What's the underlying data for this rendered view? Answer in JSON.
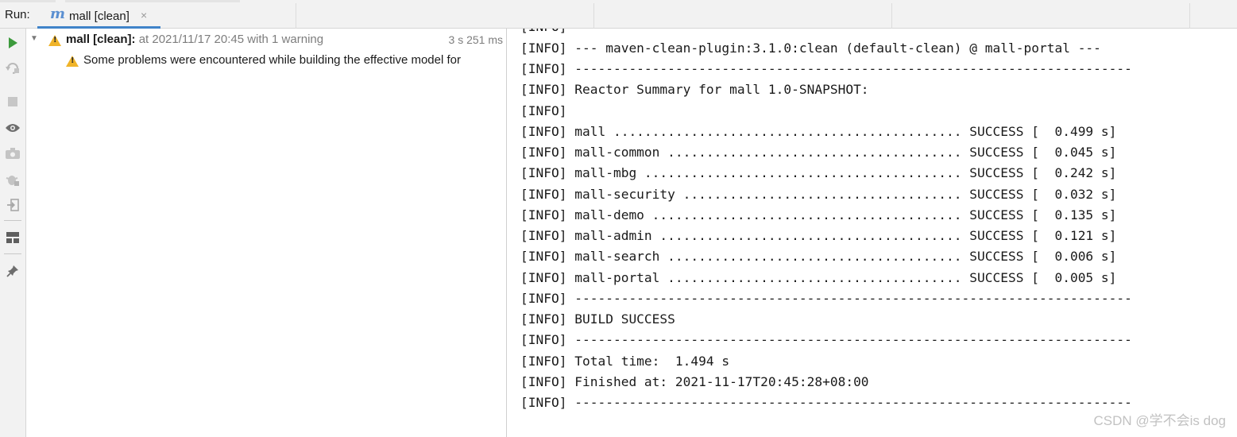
{
  "header": {
    "run_label": "Run:",
    "tab": {
      "label": "mall [clean]",
      "close": "×"
    }
  },
  "toolbar": {
    "icons": [
      "play-icon",
      "rerun-icon",
      "stop-icon",
      "eye-icon",
      "camera-icon",
      "debug-icon",
      "import-icon",
      "layout-icon",
      "pin-icon"
    ]
  },
  "tree": {
    "root": {
      "title": "mall [clean]:",
      "meta": " at 2021/11/17 20:45 with 1 warning",
      "duration": "3 s 251 ms"
    },
    "child": {
      "text": "Some problems were encountered while building the effective model for"
    }
  },
  "console": {
    "lines": [
      "[INFO]",
      "[INFO] --- maven-clean-plugin:3.1.0:clean (default-clean) @ mall-portal ---",
      "[INFO] ------------------------------------------------------------------------",
      "[INFO] Reactor Summary for mall 1.0-SNAPSHOT:",
      "[INFO]",
      "[INFO] mall ............................................. SUCCESS [  0.499 s]",
      "[INFO] mall-common ...................................... SUCCESS [  0.045 s]",
      "[INFO] mall-mbg ......................................... SUCCESS [  0.242 s]",
      "[INFO] mall-security .................................... SUCCESS [  0.032 s]",
      "[INFO] mall-demo ........................................ SUCCESS [  0.135 s]",
      "[INFO] mall-admin ....................................... SUCCESS [  0.121 s]",
      "[INFO] mall-search ...................................... SUCCESS [  0.006 s]",
      "[INFO] mall-portal ...................................... SUCCESS [  0.005 s]",
      "[INFO] ------------------------------------------------------------------------",
      "[INFO] BUILD SUCCESS",
      "[INFO] ------------------------------------------------------------------------",
      "[INFO] Total time:  1.494 s",
      "[INFO] Finished at: 2021-11-17T20:45:28+08:00",
      "[INFO] ------------------------------------------------------------------------"
    ]
  },
  "watermark": "CSDN @学不会is dog",
  "colors": {
    "accent": "#4083c9",
    "warning": "#f0b429",
    "run_green": "#3c9a3c"
  }
}
